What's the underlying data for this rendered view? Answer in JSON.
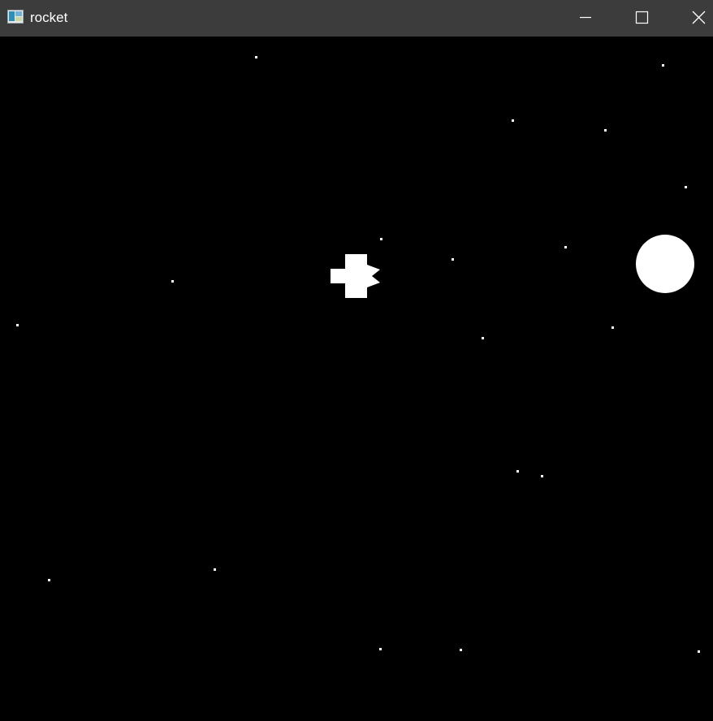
{
  "window": {
    "title": "rocket",
    "icon": "window-app-icon",
    "controls": [
      "minimize-icon",
      "maximize-icon",
      "close-icon"
    ]
  },
  "scene": {
    "background_color": "#000000",
    "star_color": "#ffffff",
    "planet_color": "#ffffff",
    "rocket_color": "#ffffff"
  }
}
